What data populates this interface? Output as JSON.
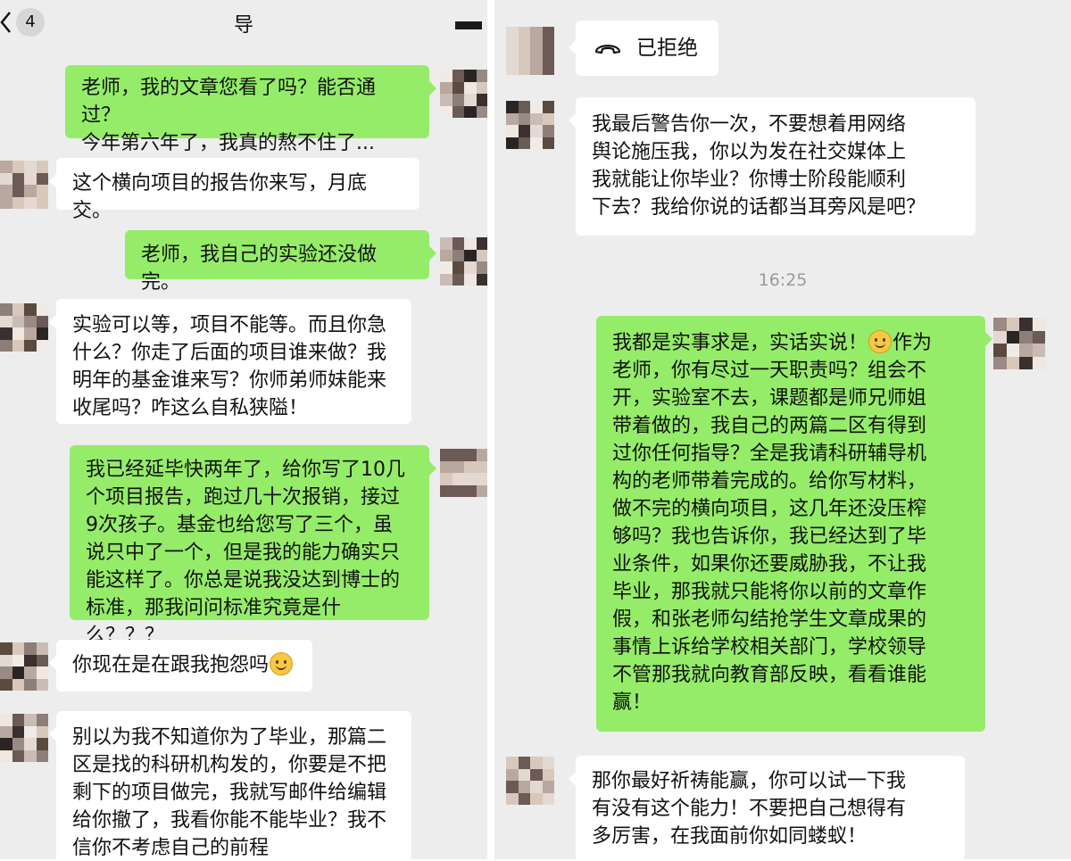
{
  "header": {
    "unread_count": "4",
    "title": "导"
  },
  "left_chat": {
    "messages": [
      {
        "side": "out",
        "text": "老师，我的文章您看了吗？能否通过？\n今年第六年了，我真的熬不住了..."
      },
      {
        "side": "in",
        "text": "这个横向项目的报告你来写，月底交。"
      },
      {
        "side": "out",
        "text": "老师，我自己的实验还没做完。"
      },
      {
        "side": "in",
        "text": "实验可以等，项目不能等。而且你急\n什么？你走了后面的项目谁来做？我\n明年的基金谁来写？你师弟师妹能来\n收尾吗？咋这么自私狭隘！"
      },
      {
        "side": "out",
        "text": "我已经延毕快两年了，给你写了10几\n个项目报告，跑过几十次报销，接过\n9次孩子。基金也给您写了三个，虽\n说只中了一个，但是我的能力确实只\n能这样了。你总是说我没达到博士的\n标准，那我问问标准究竟是什么？？？"
      },
      {
        "side": "in",
        "text": "你现在是在跟我抱怨吗",
        "emoji": "smile-emoji"
      },
      {
        "side": "in",
        "text": "别以为我不知道你为了毕业，那篇二\n区是找的科研机构发的，你要是不把\n剩下的项目做完，我就写邮件给编辑\n给你撤了，我看你能不能毕业？我不\n信你不考虑自己的前程"
      }
    ]
  },
  "right_chat": {
    "call_status": "已拒绝",
    "timestamp": "16:25",
    "messages": [
      {
        "side": "in",
        "text": "我最后警告你一次，不要想着用网络\n舆论施压我，你以为发在社交媒体上\n我就能让你毕业？你博士阶段能顺利\n下去？我给你说的话都当耳旁风是吧？"
      },
      {
        "side": "out",
        "text_before_emoji": "我都是实事求是，实话实说！",
        "emoji": "smile-emoji",
        "text_after_emoji": "作为\n老师，你有尽过一天职责吗？组会不\n开，实验室不去，课题都是师兄师姐\n带着做的，我自己的两篇二区有得到\n过你任何指导？全是我请科研辅导机\n构的老师带着完成的。给你写材料，\n做不完的横向项目，这几年还没压榨\n够吗？我也告诉你，我已经达到了毕\n业条件，如果你还要威胁我，不让我\n毕业，那我就只能将你以前的文章作\n假，和张老师勾结抢学生文章成果的\n事情上诉给学校相关部门，学校领导\n不管那我就向教育部反映，看看谁能\n赢！"
      },
      {
        "side": "in",
        "text": "那你最好祈祷能赢，你可以试一下我\n有没有这个能力！不要把自己想得有\n多厉害，在我面前你如同蝼蚁！"
      }
    ]
  },
  "colors": {
    "chat_background": "#ededed",
    "outgoing_bubble": "#95ec69",
    "incoming_bubble": "#ffffff"
  }
}
